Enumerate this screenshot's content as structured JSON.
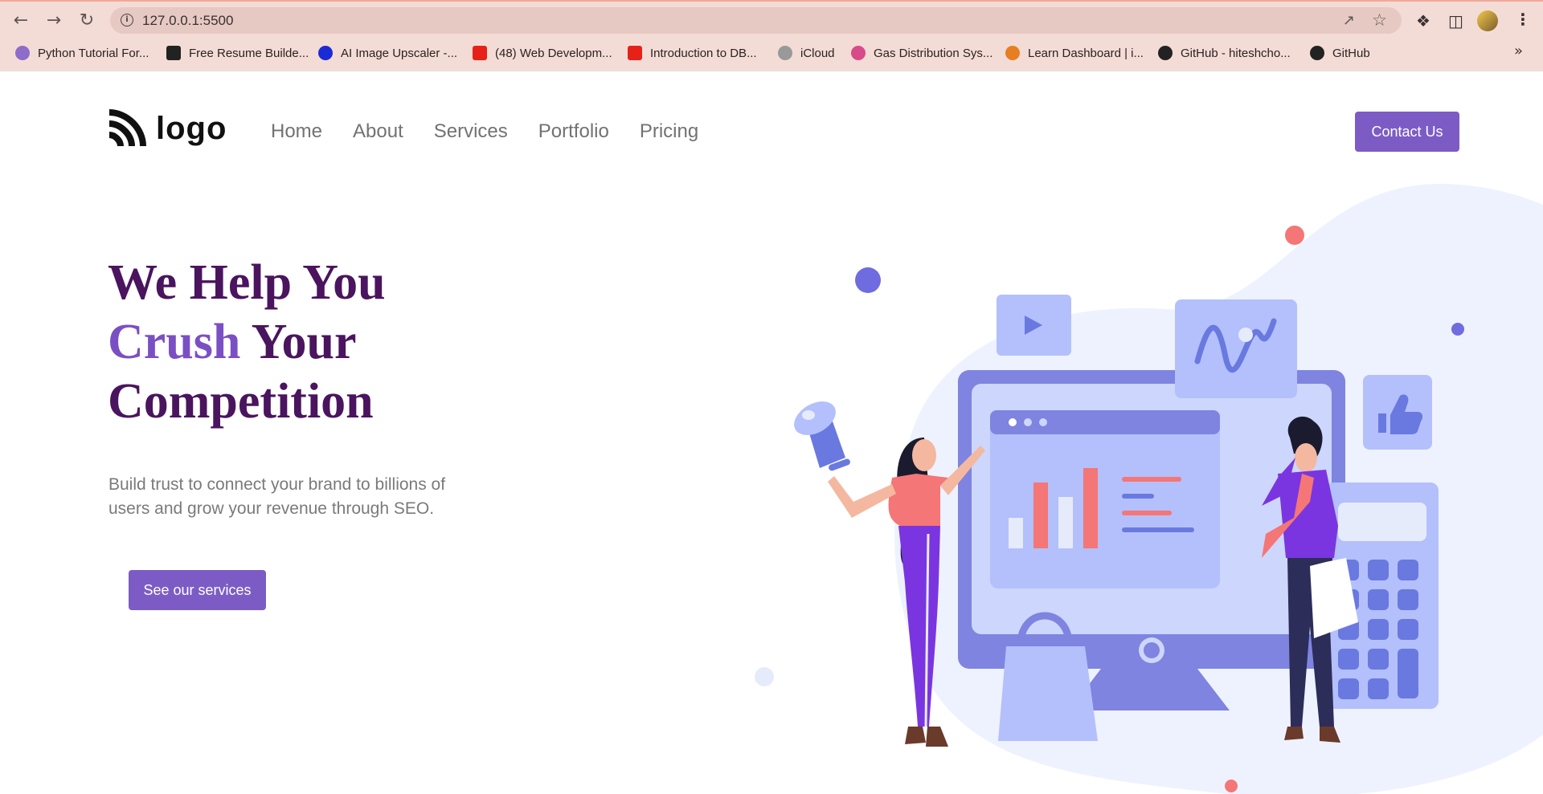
{
  "browser": {
    "url": "127.0.0.1:5500",
    "bookmarks": [
      {
        "label": "Python Tutorial For...",
        "color": "#8e6cc9"
      },
      {
        "label": "Free Resume Builde...",
        "color": "#222222"
      },
      {
        "label": "AI Image Upscaler -...",
        "color": "#1a2bd6"
      },
      {
        "label": "(48) Web Developm...",
        "color": "#e62117"
      },
      {
        "label": "Introduction to DB...",
        "color": "#e62117"
      },
      {
        "label": "iCloud",
        "color": "#777777"
      },
      {
        "label": "Gas Distribution Sys...",
        "color": "#d84a8a"
      },
      {
        "label": "Learn Dashboard | i...",
        "color": "#e67e22"
      },
      {
        "label": "GitHub - hiteshcho...",
        "color": "#222222"
      },
      {
        "label": "GitHub",
        "color": "#222222"
      }
    ]
  },
  "header": {
    "logo_text": "logo",
    "nav": [
      "Home",
      "About",
      "Services",
      "Portfolio",
      "Pricing"
    ],
    "contact_label": "Contact Us"
  },
  "hero": {
    "title_line1": "We Help You",
    "title_accent": "Crush",
    "title_line2_rest": " Your",
    "title_line3": "Competition",
    "description": "Build trust to connect your brand to billions of users and grow your revenue through SEO.",
    "cta_label": "See our services"
  },
  "colors": {
    "brand": "#7c5cc4",
    "title": "#4a145e",
    "accent": "#7b4fc4"
  }
}
